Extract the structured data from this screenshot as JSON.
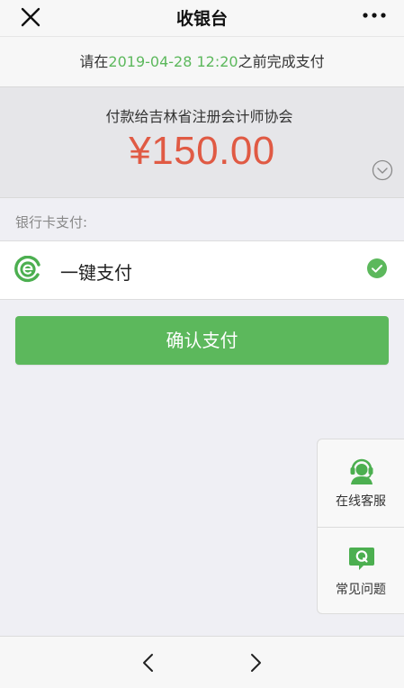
{
  "navbar": {
    "title": "收银台",
    "close_icon": "close-icon",
    "more_icon": "more-options-icon"
  },
  "notice": {
    "prefix": "请在",
    "deadline": "2019-04-28 12:20",
    "suffix": "之前完成支付"
  },
  "payment": {
    "payee": "付款给吉林省注册会计师协会",
    "amount": "¥150.00",
    "expand_icon": "chevron-down-circle-icon"
  },
  "methods": {
    "section_label": "银行卡支付:",
    "items": [
      {
        "label": "一键支付",
        "icon": "e-pay-logo-icon",
        "selected": true
      }
    ]
  },
  "confirm_button": {
    "label": "确认支付"
  },
  "side_panel": {
    "items": [
      {
        "label": "在线客服",
        "icon": "customer-service-icon"
      },
      {
        "label": "常见问题",
        "icon": "faq-q-icon"
      }
    ]
  },
  "bottom_nav": {
    "back_icon": "chevron-left-icon",
    "forward_icon": "chevron-right-icon"
  },
  "colors": {
    "brand_green": "#5cb85c",
    "amount_red": "#e05a44",
    "background": "#efeff4"
  }
}
